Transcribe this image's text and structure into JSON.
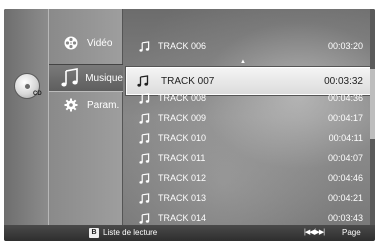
{
  "disc": {
    "label": "CD"
  },
  "menu": {
    "items": [
      {
        "label": "Vidéo",
        "icon": "film-reel-icon"
      },
      {
        "label": "Musique",
        "icon": "music-note-icon",
        "selected": true
      },
      {
        "label": "Param.",
        "icon": "gear-icon"
      }
    ]
  },
  "tracks": [
    {
      "name": "TRACK 006",
      "time": "00:03:20"
    },
    {
      "name": "TRACK 007",
      "time": "00:03:32",
      "selected": true
    },
    {
      "name": "TRACK 008",
      "time": "00:04:36"
    },
    {
      "name": "TRACK 009",
      "time": "00:04:17"
    },
    {
      "name": "TRACK 010",
      "time": "00:04:11"
    },
    {
      "name": "TRACK 011",
      "time": "00:04:07"
    },
    {
      "name": "TRACK 012",
      "time": "00:04:46"
    },
    {
      "name": "TRACK 013",
      "time": "00:04:21"
    },
    {
      "name": "TRACK 014",
      "time": "00:03:43"
    }
  ],
  "bottom_bar": {
    "button_key": "B",
    "playlist_label": "Liste de lecture",
    "page_icon": "|◀◀/▶▶|",
    "page_label": "Page"
  }
}
